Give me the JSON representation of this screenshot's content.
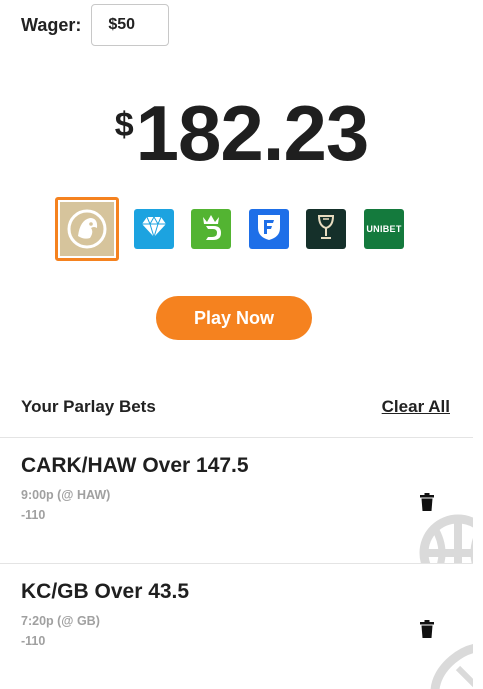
{
  "wager": {
    "label": "Wager:",
    "value": "$50"
  },
  "payout": {
    "currency": "$",
    "amount": "182.23"
  },
  "sportsbooks": [
    {
      "name": "BetMGM",
      "icon": "lion-logo-icon",
      "color": "#d6c49c",
      "selected": true
    },
    {
      "name": "Caesars Diamond",
      "icon": "diamond-logo-icon",
      "color": "#1ca3e0"
    },
    {
      "name": "DraftKings",
      "icon": "draftkings-crown-icon",
      "color": "#53b432"
    },
    {
      "name": "FanDuel",
      "icon": "fanduel-shield-icon",
      "color": "#1e6fe8"
    },
    {
      "name": "Caesars",
      "icon": "goblet-logo-icon",
      "color": "#15302a"
    },
    {
      "name": "Unibet",
      "icon": "unibet-logo-icon",
      "color": "#147a3d",
      "text": "UNIBET"
    }
  ],
  "play_button": {
    "label": "Play Now",
    "color": "#f5821f"
  },
  "parlay": {
    "title": "Your Parlay Bets",
    "clear_label": "Clear All",
    "bets": [
      {
        "title": "CARK/HAW Over 147.5",
        "time": "9:00p (@ HAW)",
        "odds": "-110",
        "sport_icon": "basketball-icon"
      },
      {
        "title": "KC/GB Over 43.5",
        "time": "7:20p (@ GB)",
        "odds": "-110",
        "sport_icon": "football-icon"
      }
    ]
  }
}
